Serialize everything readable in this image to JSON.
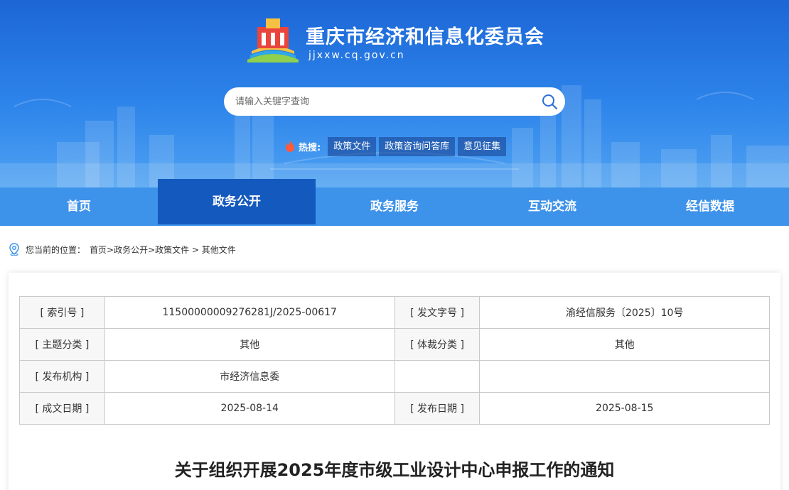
{
  "header": {
    "title": "重庆市经济和信息化委员会",
    "url": "jjxxw.cq.gov.cn"
  },
  "search": {
    "placeholder": "请输入关键字查询",
    "value": ""
  },
  "hot_search": {
    "label": "热搜:",
    "tags": [
      "政策文件",
      "政策咨询问答库",
      "意见征集"
    ]
  },
  "nav": {
    "items": [
      "首页",
      "政务公开",
      "政务服务",
      "互动交流",
      "经信数据"
    ],
    "active_index": 1
  },
  "breadcrumb": {
    "prefix": "您当前的位置：",
    "path": "首页>政务公开>政策文件 > 其他文件"
  },
  "info_table": {
    "rows": [
      [
        "[ 索引号 ]",
        "11500000009276281J/2025-00617",
        "[ 发文字号 ]",
        "渝经信服务〔2025〕10号"
      ],
      [
        "[ 主题分类 ]",
        "其他",
        "[ 体裁分类 ]",
        "其他"
      ],
      [
        "[ 发布机构 ]",
        "市经济信息委",
        "",
        ""
      ],
      [
        "[ 成文日期 ]",
        "2025-08-14",
        "[ 发布日期 ]",
        "2025-08-15"
      ]
    ]
  },
  "document": {
    "title": "关于组织开展2025年度市级工业设计中心申报工作的通知"
  },
  "colors": {
    "header_top": "#1c66d6",
    "nav_bg": "#3d92ea",
    "nav_active": "#1459bd",
    "hot_flame": "#ff5a3c"
  },
  "icons": {
    "search": "search-icon",
    "flame": "flame-icon",
    "location": "location-pin-icon",
    "logo": "logo-emblem-icon"
  }
}
